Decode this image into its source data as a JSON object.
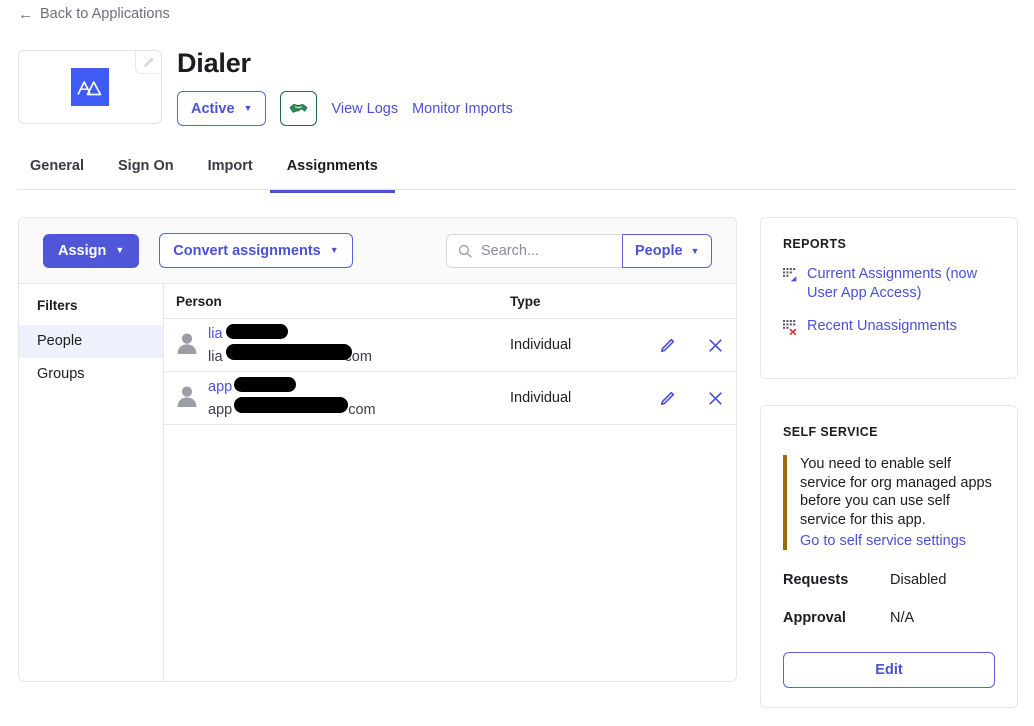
{
  "back_link": {
    "label": "Back to Applications",
    "icon": "arrow-left-icon"
  },
  "app": {
    "title": "Dialer",
    "logo_alt": "dialer-app-logo",
    "logo_color": "#3f5bf6",
    "edit_icon": "pencil-icon",
    "status": {
      "label": "Active",
      "caret": "▼"
    },
    "provisioning_icon": "handshake-icon",
    "links": [
      {
        "label": "View Logs"
      },
      {
        "label": "Monitor Imports"
      }
    ]
  },
  "tabs": [
    {
      "label": "General",
      "active": false
    },
    {
      "label": "Sign On",
      "active": false
    },
    {
      "label": "Import",
      "active": false
    },
    {
      "label": "Assignments",
      "active": true
    }
  ],
  "toolbar": {
    "assign_label": "Assign",
    "convert_label": "Convert assignments",
    "caret": "▼",
    "search_placeholder": "Search...",
    "search_value": "",
    "search_icon": "search-icon",
    "scope_label": "People"
  },
  "filters": {
    "title": "Filters",
    "items": [
      {
        "label": "People",
        "active": true
      },
      {
        "label": "Groups",
        "active": false
      }
    ]
  },
  "table": {
    "columns": {
      "person": "Person",
      "type": "Type"
    },
    "rows": [
      {
        "name_prefix": "lia",
        "name_redacted": true,
        "email_prefix": "lia",
        "email_suffix": "com",
        "type": "Individual",
        "avatar_icon": "user-avatar-icon",
        "edit_icon": "pencil-icon",
        "remove_icon": "close-icon"
      },
      {
        "name_prefix": "app",
        "name_redacted": true,
        "email_prefix": "app",
        "email_suffix": "com",
        "type": "Individual",
        "avatar_icon": "user-avatar-icon",
        "edit_icon": "pencil-icon",
        "remove_icon": "close-icon"
      }
    ]
  },
  "reports": {
    "title": "REPORTS",
    "items": [
      {
        "label": "Current Assignments (now User App Access)",
        "icon": "report-grid-arrow-icon"
      },
      {
        "label": "Recent Unassignments",
        "icon": "report-grid-x-icon"
      }
    ]
  },
  "self_service": {
    "title": "SELF SERVICE",
    "note": "You need to enable self service for org managed apps before you can use self service for this app.",
    "note_accent": "#9a6a10",
    "link": "Go to self service settings",
    "requests_key": "Requests",
    "requests_value": "Disabled",
    "approval_key": "Approval",
    "approval_value": "N/A",
    "edit_label": "Edit"
  },
  "colors": {
    "accent_blue": "#4a51d6",
    "primary_button": "#4f57d8",
    "logo_blue": "#3f5bf6",
    "provisioning_green": "#1f6b45",
    "warning_amber": "#9a6a10"
  }
}
